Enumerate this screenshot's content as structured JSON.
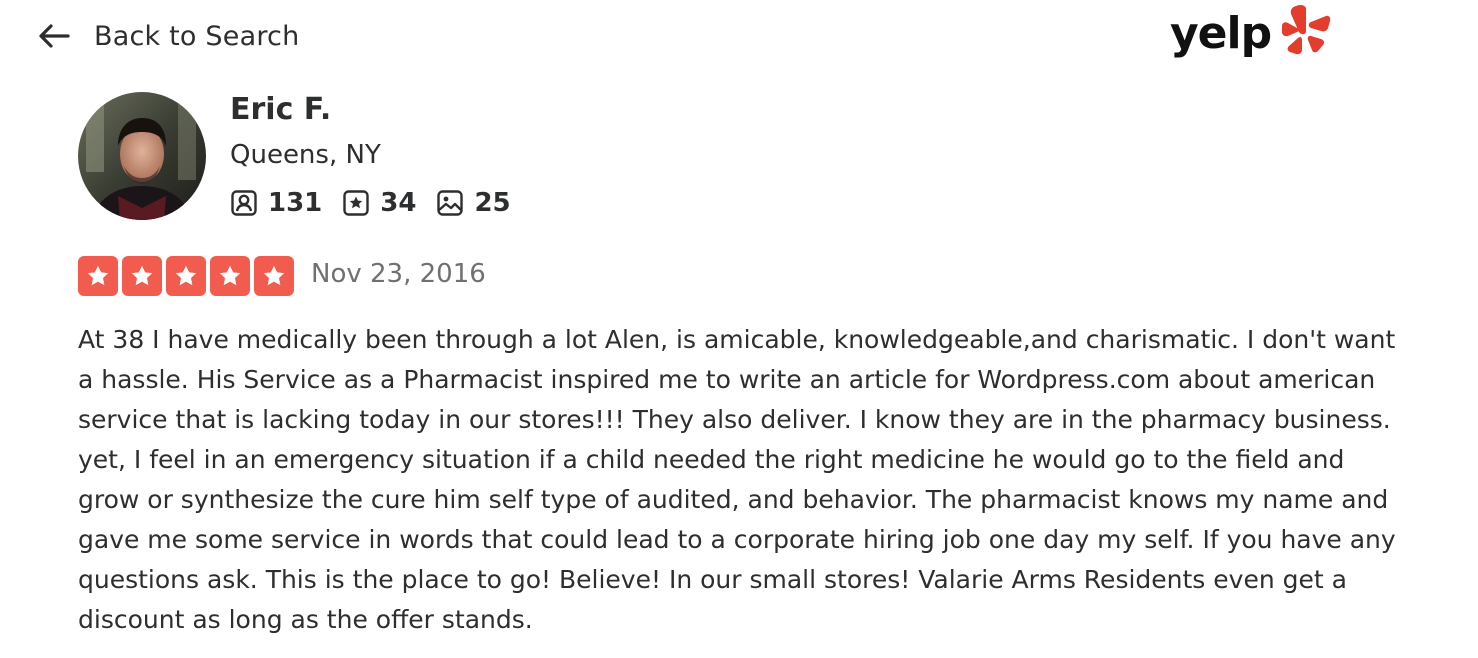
{
  "nav": {
    "back_label": "Back to Search",
    "back_icon": "arrow-left-icon"
  },
  "logo": {
    "text": "yelp",
    "icon": "yelp-burst-icon",
    "brand_color": "#d32323"
  },
  "user": {
    "name": "Eric F.",
    "location": "Queens, NY",
    "stats": {
      "friends": "131",
      "reviews": "34",
      "photos": "25"
    }
  },
  "review": {
    "rating": 5,
    "max_rating": 5,
    "star_color": "#f15c4f",
    "date": "Nov 23, 2016",
    "text": "At 38 I have medically been through a lot Alen, is amicable, knowledgeable,and charismatic. I don't want a hassle. His Service as a Pharmacist inspired me to write an article for Wordpress.com about american service that is lacking today in our stores!!! They also deliver. I know they are in the pharmacy business. yet, I feel in an emergency situation if a child needed the right medicine he would go to the field and grow or synthesize the cure him self type of audited, and behavior. The pharmacist knows my name and gave me some service in words that could lead to a corporate hiring job one day my self. If you have any questions ask. This is the place to go! Believe! In our small stores! Valarie Arms Residents even get a discount as long as the offer stands."
  }
}
